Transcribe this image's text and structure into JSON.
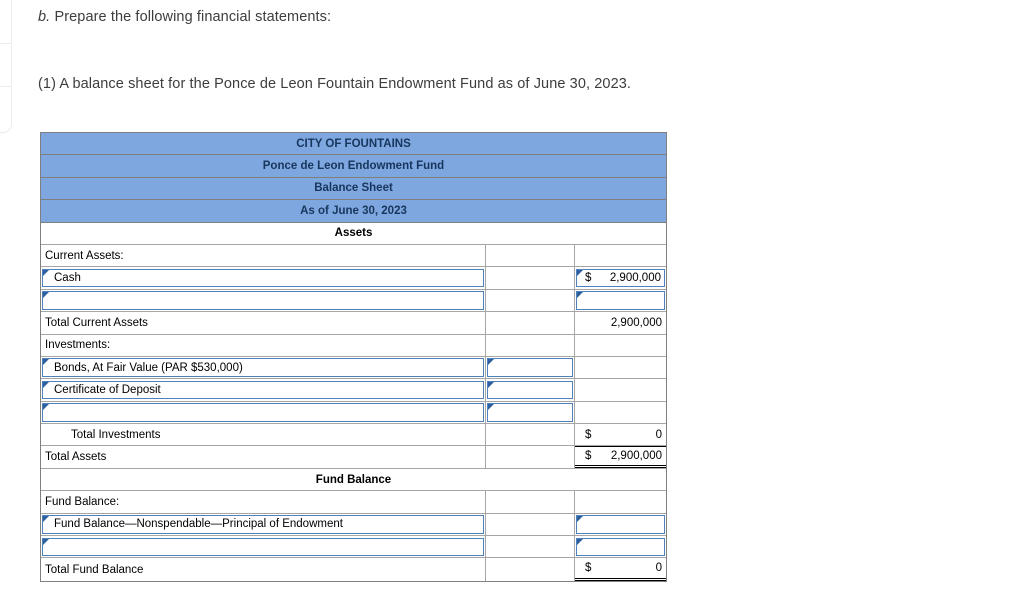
{
  "instructions": {
    "item_b_prefix": "b.",
    "item_b_text": "Prepare the following financial statements:",
    "item_1_text": "(1) A balance sheet for the Ponce de Leon Fountain Endowment Fund as of June 30, 2023."
  },
  "statement": {
    "title_lines": [
      "CITY OF FOUNTAINS",
      "Ponce de Leon Endowment Fund",
      "Balance Sheet",
      "As of June 30, 2023"
    ],
    "sections": {
      "assets": "Assets",
      "fund_balance": "Fund Balance"
    },
    "rows": {
      "current_assets_heading": "Current Assets:",
      "cash_label": "Cash",
      "cash_dollar": "$",
      "cash_amount": "2,900,000",
      "total_current_assets_label": "Total Current Assets",
      "total_current_assets_amount": "2,900,000",
      "investments_heading": "Investments:",
      "bonds_label": "Bonds, At Fair Value (PAR $530,000)",
      "cod_label": "Certificate of Deposit",
      "total_investments_label": "Total Investments",
      "total_investments_dollar": "$",
      "total_investments_amount": "0",
      "total_assets_label": "Total Assets",
      "total_assets_dollar": "$",
      "total_assets_amount": "2,900,000",
      "fund_balance_heading": "Fund Balance:",
      "fb_nonspendable_label": "Fund Balance—Nonspendable—Principal of Endowment",
      "total_fund_balance_label": "Total Fund Balance",
      "total_fund_balance_dollar": "$",
      "total_fund_balance_amount": "0"
    }
  },
  "colors": {
    "header_fill": "#7FA7DF",
    "header_text": "#17365d",
    "input_border": "#4f81bd",
    "input_marker": "#2e5f9e",
    "grid_line": "#a6a6a6",
    "outer_border": "#808080",
    "sum_line": "#000000"
  }
}
